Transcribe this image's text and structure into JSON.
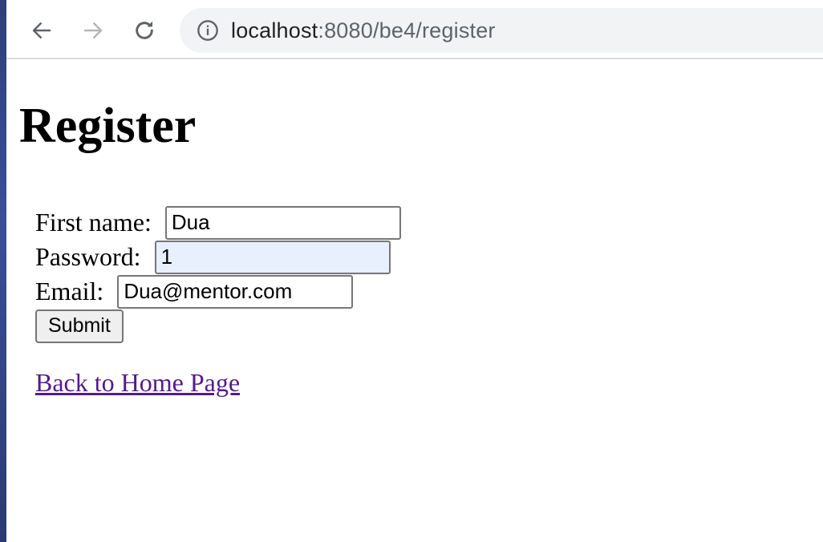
{
  "browser": {
    "url_host": "localhost",
    "url_path": ":8080/be4/register",
    "icons": {
      "back": "arrow-left-icon",
      "forward": "arrow-right-icon",
      "reload": "reload-icon",
      "site_info": "info-icon"
    }
  },
  "page": {
    "title": "Register",
    "form": {
      "first_name_label": "First name: ",
      "first_name_value": "Dua",
      "password_label": "Password: ",
      "password_value": "1",
      "email_label": "Email: ",
      "email_value": "Dua@mentor.com",
      "submit_label": "Submit"
    },
    "home_link": "Back to Home Page"
  },
  "colors": {
    "link_visited": "#551a8b",
    "autofill_bg": "#e8f0fe",
    "omnibox_bg": "#f1f3f4"
  }
}
